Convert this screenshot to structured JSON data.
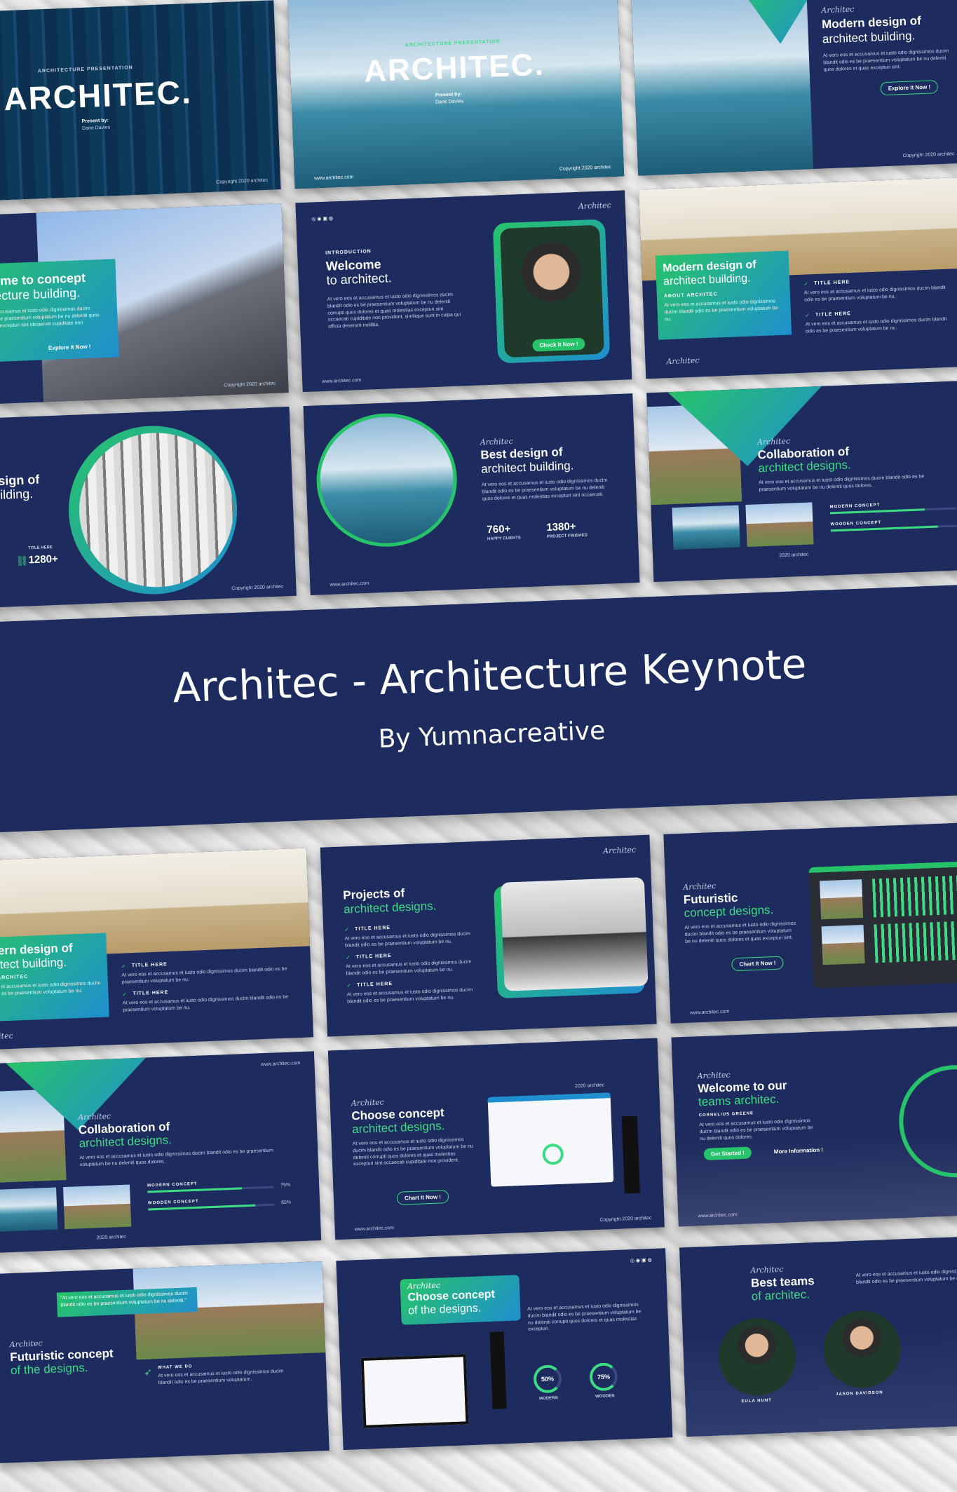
{
  "banner": {
    "title": "Architec - Architecture Keynote",
    "subtitle": "By Yumnacreative"
  },
  "colors": {
    "navy": "#1d2b5e",
    "green": "#3ddc84",
    "blue": "#1f8fcf",
    "marble": "#ececec"
  },
  "slides": {
    "cover_dark": {
      "tag": "ARCHITECTURE PRESENTATION",
      "title": "ARCHITEC.",
      "present": "Present by:",
      "name": "Dane Davies",
      "copy": "Copyright 2020 architec"
    },
    "cover_pool": {
      "tag": "ARCHITECTURE PRESENTATION",
      "title": "ARCHITEC.",
      "present": "Present by:",
      "name": "Dane Davies",
      "url": "www.architec.com",
      "copy": "Copyright 2020 architec"
    },
    "modern_top": {
      "script": "Architec",
      "title": "Modern design of",
      "title2": "architect building.",
      "body": "At vero eos et accusamus et iusto odio dignissimos ducim blandit odio es be praesentium voluptatum be nu deleniti quos dolores et quas excepturi sint.",
      "button": "Explore It Now !",
      "copy": "Copyright 2020 architec"
    },
    "welcome_concept": {
      "title": "Welcome to concept",
      "title2": "architecture building.",
      "body": "At vero eos et accusamus et iusto odio dignissimos ducim blandit odio es be praesentium voluptatum be nu deleniti quos dolores et quas excepturi sint obcaecati cupiditate non provident.",
      "button": "Explore It Now !",
      "copy": "Copyright 2020 architec"
    },
    "welcome": {
      "tag": "INTRODUCTION",
      "title": "Welcome",
      "title2": "to architect.",
      "body": "At vero eos et accusamus et iusto odio dignissimos ducim blandit odio es be praesentium voluptatum be nu deleniti corrupti quos dolores et quas molestias excepturi sint occaecati cupiditate non provident, similique sunt in culpa qui officia deserunt mollitia.",
      "button": "Check It Now !",
      "script": "Architec",
      "url": "www.architec.com"
    },
    "modern_room": {
      "title": "Modern design of",
      "title2": "architect building.",
      "about": "ABOUT ARCHITEC",
      "item1": "TITLE HERE",
      "item2": "TITLE HERE",
      "body": "At vero eos et accusamus et iusto odio dignissimos ducim blandit odio es be praesentium voluptatum be nu.",
      "script": "Architec"
    },
    "design_atrium": {
      "title": "Modern design of",
      "title2": "architect building.",
      "stat_label": "TITLE HERE",
      "stat": "1280+",
      "copy": "Copyright 2020 architec"
    },
    "best_design": {
      "script": "Architec",
      "title": "Best design of",
      "title2": "architect building.",
      "body": "At vero eos et accusamus et iusto odio dignissimos ducim blandit odio es be praesentium voluptatum be nu deleniti quos dolores et quas molestias excepturi sint occaecati.",
      "stat1": "760+",
      "stat1_label": "HAPPY CLIENTS",
      "stat2": "1380+",
      "stat2_label": "PROJECT FINISHED",
      "url": "www.architec.com"
    },
    "collab_top": {
      "script": "Architec",
      "title": "Collaboration of",
      "title2": "architect designs.",
      "body": "At vero eos et accusamus et iusto odio dignissimos ducim blandit odio es be praesentium voluptatum be nu deleniti quos dolores.",
      "bar1": "MODERN CONCEPT",
      "bar2": "WOODEN CONCEPT",
      "year": "2020 architec"
    },
    "modern_room_2": {
      "title": "Modern design of",
      "title2": "architect building.",
      "about": "ABOUT ARCHITEC",
      "item1": "TITLE HERE",
      "item2": "TITLE HERE",
      "body": "At vero eos et accusamus et iusto odio dignissimos ducim blandit odio es be praesentium voluptatum be nu.",
      "script": "Architec"
    },
    "projects": {
      "title": "Projects of",
      "title2": "architect designs.",
      "item1": "TITLE HERE",
      "item2": "TITLE HERE",
      "item3": "TITLE HERE",
      "body": "At vero eos et accusamus et iusto odio dignissimos ducim blandit odio es be praesentium voluptatum be nu.",
      "script": "Architec"
    },
    "futuristic": {
      "script": "Architec",
      "title": "Futuristic",
      "title2": "concept designs.",
      "body": "At vero eos et accusamus et iusto odio dignissimos ducim blandit odio es be praesentium voluptatum be nu deleniti quos dolores et quas excepturi sint.",
      "button": "Chart It Now !",
      "url": "www.architec.com"
    },
    "collab_bottom": {
      "script": "Architec",
      "title": "Collaboration of",
      "title2": "architect designs.",
      "body": "At vero eos et accusamus et iusto odio dignissimos ducim blandit odio es be praesentium voluptatum be nu deleniti quos dolores.",
      "bar1": "MODERN CONCEPT",
      "bar1_pct": "75%",
      "bar1_val": 0.75,
      "bar2": "WOODEN CONCEPT",
      "bar2_pct": "85%",
      "bar2_val": 0.85,
      "year": "2020 architec",
      "url": "www.architec.com"
    },
    "choose": {
      "script": "Architec",
      "title": "Choose concept",
      "title2": "architect designs.",
      "body": "At vero eos et accusamus et iusto odio dignissimos ducim blandit odio es be praesentium voluptatum be nu deleniti corrupti quos dolores et quas molestias excepturi sint occaecati cupiditate non provident.",
      "button": "Chart It Now !",
      "year": "2020 architec",
      "url": "www.architec.com",
      "copy": "Copyright 2020 architec"
    },
    "welcome_team": {
      "script": "Architec",
      "title": "Welcome to our",
      "title2": "teams architec.",
      "name": "CORNELIUS GREENE",
      "body": "At vero eos et accusamus et iusto odio dignissimos ducim blandit odio es be praesentium voluptatum be nu deleniti quos dolores.",
      "btn1": "Get Started !",
      "btn2": "More Information !",
      "url": "www.architec.com"
    },
    "futuristic_2": {
      "script": "Architec",
      "title": "Futuristic concept",
      "title2": "of the designs.",
      "quote": "\"At vero eos et accusamus et iusto odio dignissimos ducim blandit odio es be praesentium voluptatum be nu deleniti.\"",
      "what": "WHAT WE DO",
      "body": "At vero eos et accusamus et iusto odio dignissimos ducim blandit odio es be praesentium voluptatum."
    },
    "choose_2": {
      "script": "Architec",
      "title": "Choose concept",
      "title2": "of the designs.",
      "body": "At vero eos et accusamus et iusto odio dignissimos ducim blandit odio es be praesentium voluptatum be nu deleniti corrupti quos dolores et quas molestias excepturi.",
      "p1": "50%",
      "p1_label": "MODERN",
      "p2": "75%",
      "p2_label": "WOODEN"
    },
    "best_teams": {
      "script": "Architec",
      "title": "Best teams",
      "title2": "of architec.",
      "body": "At vero eos et accusamus et iusto odio dignissimos ducim blandit odio es be praesentium voluptatum be nu deleniti.",
      "member1": "EULA HUNT",
      "member2": "JASON DAVIDSON"
    }
  }
}
